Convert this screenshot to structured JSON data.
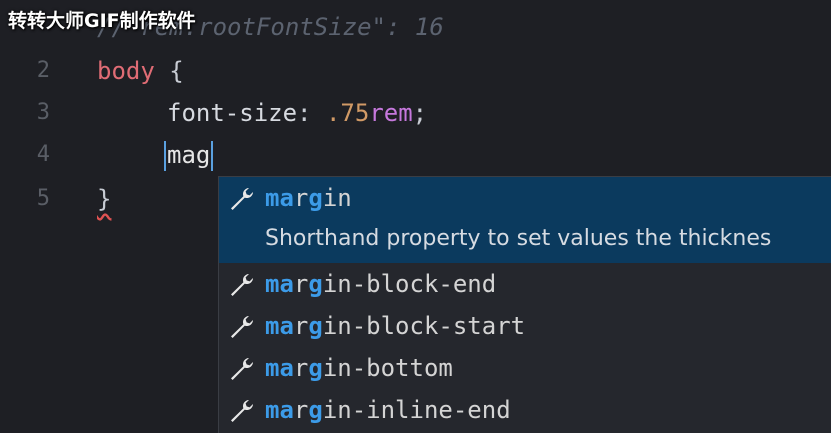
{
  "watermark": "转转大师GIF制作软件",
  "editor": {
    "line1": {
      "comment": "// rem.rootFontSize\": 16"
    },
    "line2": {
      "num": "2",
      "selector": "body",
      "brace": "{"
    },
    "line3": {
      "num": "3",
      "property": "font-size",
      "colon": ":",
      "value_num": ".75",
      "value_unit": "rem",
      "semi": ";"
    },
    "line4": {
      "num": "4",
      "typed": "mag"
    },
    "line5": {
      "num": "5",
      "brace": "}"
    }
  },
  "suggest": {
    "items": [
      {
        "match": "mar",
        "rest_a": "g",
        "match_b": "",
        "label_full": "margin"
      },
      {
        "label_full": "margin-block-end"
      },
      {
        "label_full": "margin-block-start"
      },
      {
        "label_full": "margin-bottom"
      },
      {
        "label_full": "margin-inline-end"
      }
    ],
    "detail": "Shorthand property to set values the thicknes",
    "icon": "wrench-icon"
  }
}
